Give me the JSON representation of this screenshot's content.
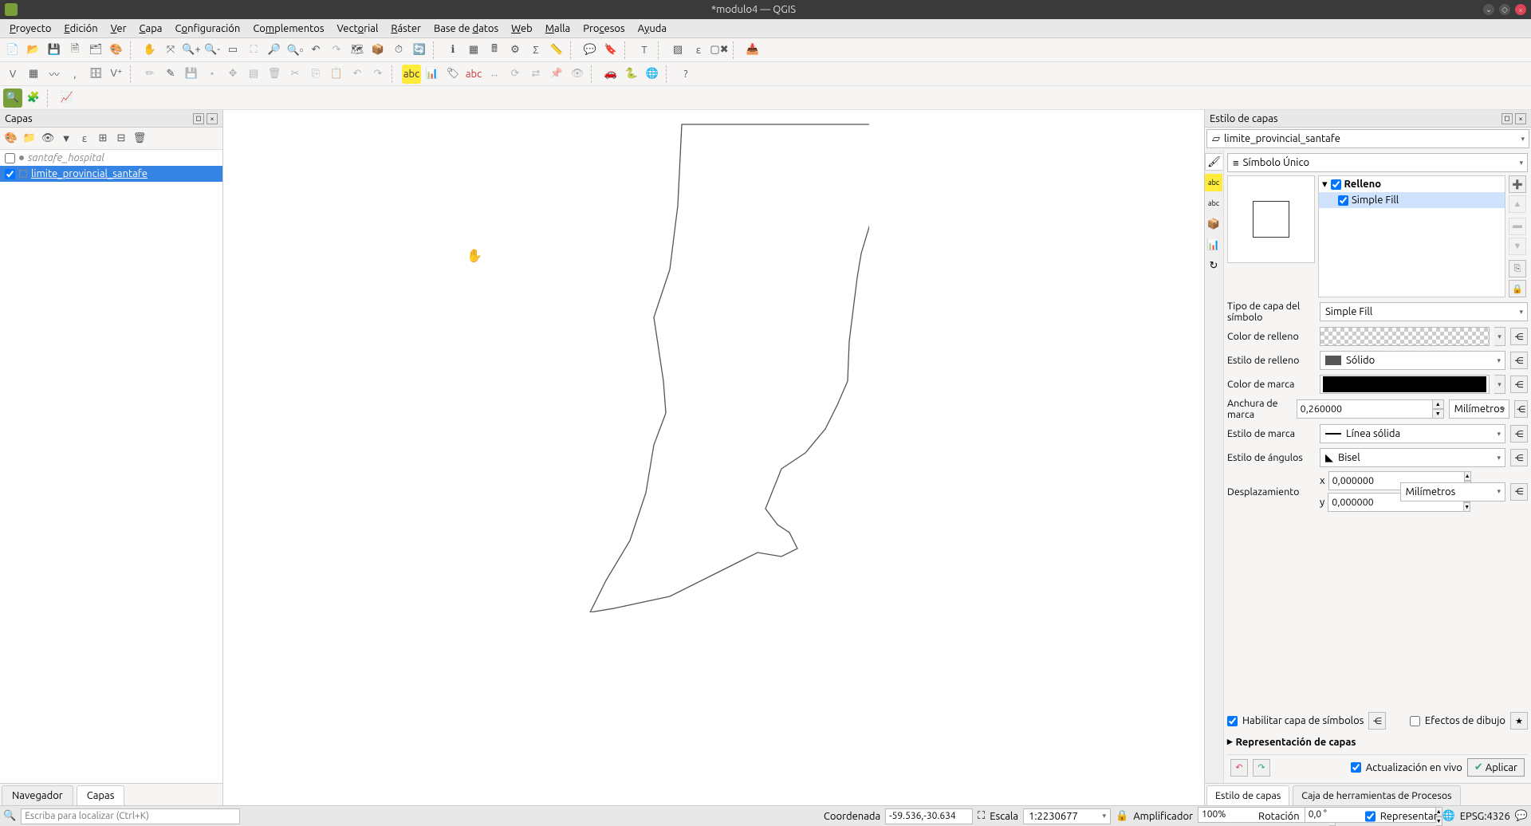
{
  "window": {
    "title": "*modulo4 — QGIS"
  },
  "menu": [
    "Proyecto",
    "Edición",
    "Ver",
    "Capa",
    "Configuración",
    "Complementos",
    "Vectorial",
    "Ráster",
    "Base de datos",
    "Web",
    "Malla",
    "Procesos",
    "Ayuda"
  ],
  "layers_panel": {
    "title": "Capas",
    "layers": [
      {
        "checked": false,
        "type": "point",
        "name": "santafe_hospital",
        "italic": true
      },
      {
        "checked": true,
        "type": "poly",
        "name": "limite_provincial_santafe",
        "selected": true
      }
    ],
    "tabs": [
      "Navegador",
      "Capas"
    ],
    "active_tab": 1
  },
  "style_panel": {
    "title": "Estilo de capas",
    "layer_selector": "limite_provincial_santafe",
    "renderer": "Símbolo Único",
    "symbol_tree": {
      "root": "Relleno",
      "child": "Simple Fill"
    },
    "symbol_type_label": "Tipo de capa del símbolo",
    "symbol_type_value": "Simple Fill",
    "props": {
      "fill_color_label": "Color de relleno",
      "fill_style_label": "Estilo de relleno",
      "fill_style_value": "Sólido",
      "stroke_color_label": "Color de marca",
      "stroke_width_label": "Anchura de marca",
      "stroke_width_value": "0,260000",
      "stroke_width_unit": "Milímetros",
      "stroke_style_label": "Estilo de marca",
      "stroke_style_value": "Línea sólida",
      "join_style_label": "Estilo de ángulos",
      "join_style_value": "Bisel",
      "offset_label": "Desplazamiento",
      "offset_x": "0,000000",
      "offset_y": "0,000000",
      "offset_unit": "Milímetros"
    },
    "enable_symbol_layer": "Habilitar capa de símbolos",
    "draw_effects": "Efectos de dibujo",
    "layer_rendering": "Representación de capas",
    "live_update": "Actualización en vivo",
    "apply": "Aplicar",
    "tabs": [
      "Estilo de capas",
      "Caja de herramientas de Procesos"
    ],
    "active_tab": 0
  },
  "statusbar": {
    "locator_placeholder": "Escriba para localizar (Ctrl+K)",
    "coord_label": "Coordenada",
    "coord_value": "-59.536,-30.634",
    "scale_label": "Escala",
    "scale_value": "1:2230677",
    "magnifier_label": "Amplificador",
    "magnifier_value": "100%",
    "rotation_label": "Rotación",
    "rotation_value": "0,0 °",
    "render_label": "Representar",
    "crs": "EPSG:4326"
  }
}
